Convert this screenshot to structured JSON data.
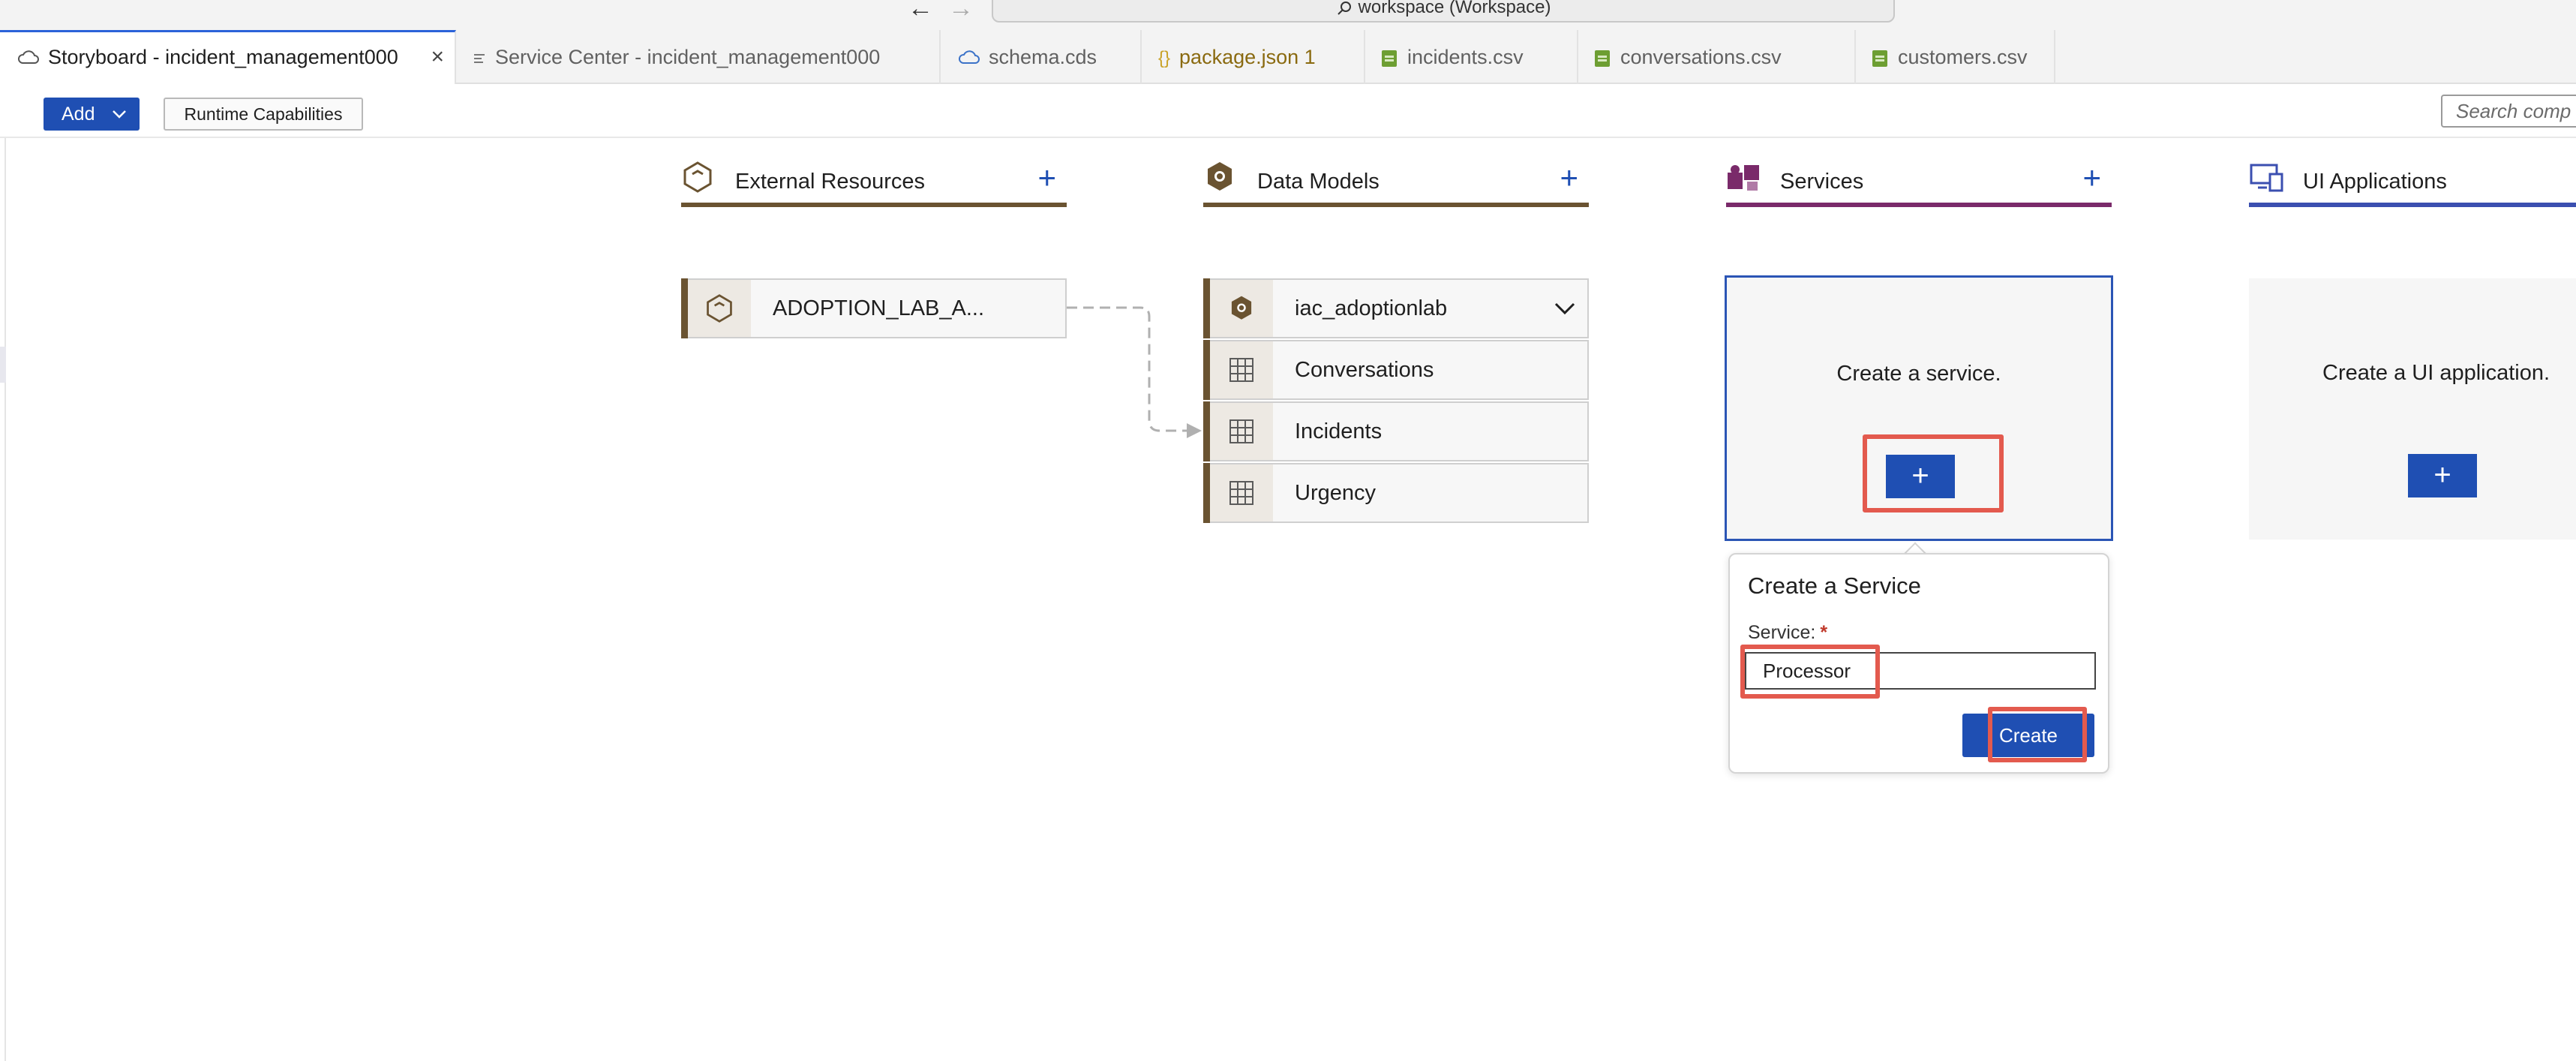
{
  "titlebar": {
    "command_center": "workspace (Workspace)",
    "back_arrow": "←",
    "forward_arrow": "→"
  },
  "tabs": [
    {
      "label": "Storyboard - incident_management000",
      "icon": "cloud-icon",
      "active": true,
      "close": "×"
    },
    {
      "label": "Service Center - incident_management000",
      "icon": "list-icon"
    },
    {
      "label": "schema.cds",
      "icon": "cloud-icon"
    },
    {
      "label": "package.json 1",
      "icon": "braces-icon"
    },
    {
      "label": "incidents.csv",
      "icon": "csv-icon"
    },
    {
      "label": "conversations.csv",
      "icon": "csv-icon"
    },
    {
      "label": "customers.csv",
      "icon": "csv-icon"
    }
  ],
  "toolbar": {
    "add_label": "Add",
    "runtime_label": "Runtime Capabilities",
    "search_placeholder": "Search comp"
  },
  "columns": {
    "external": {
      "title": "External Resources",
      "plus": "+",
      "color": "#6a5331"
    },
    "models": {
      "title": "Data Models",
      "plus": "+",
      "color": "#6a5331"
    },
    "services": {
      "title": "Services",
      "plus": "+",
      "color": "#7a2a6a"
    },
    "ui": {
      "title": "UI Applications",
      "color": "#3b4fb0"
    }
  },
  "external_resources": [
    {
      "label": "ADOPTION_LAB_A..."
    }
  ],
  "data_models": {
    "header": "iac_adoptionlab",
    "entities": [
      "Conversations",
      "Incidents",
      "Urgency"
    ]
  },
  "services_card": {
    "message": "Create a service.",
    "plus": "+"
  },
  "ui_card": {
    "message": "Create a UI application.",
    "plus": "+"
  },
  "popover": {
    "title": "Create a Service",
    "field_label": "Service:",
    "required_mark": "*",
    "field_value": "Processor",
    "create_label": "Create"
  },
  "colors": {
    "accent": "#1f4fb3",
    "highlight": "#e35a4e"
  }
}
